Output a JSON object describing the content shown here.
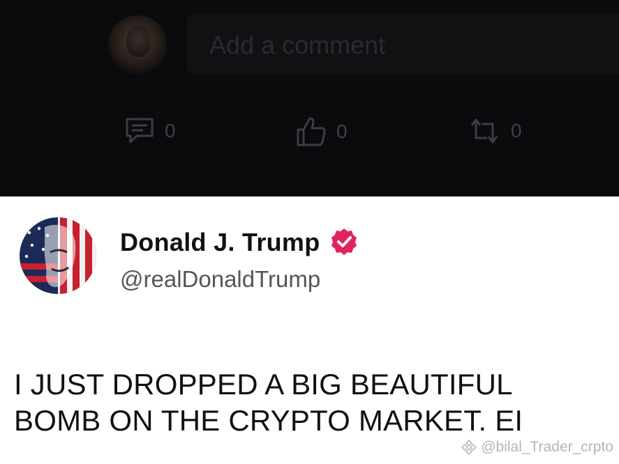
{
  "comment_section": {
    "input_placeholder": "Add a comment",
    "actions": {
      "comments_count": "0",
      "likes_count": "0",
      "reposts_count": "0"
    }
  },
  "tweet": {
    "author_name": "Donald J. Trump",
    "handle": "@realDonaldTrump",
    "verified_badge_color": "#e0245e",
    "text_line_1": "I JUST DROPPED A BIG BEAUTIFUL",
    "text_line_2": "BOMB ON THE CRYPTO MARKET. EI"
  },
  "watermark": {
    "text": "@bilal_Trader_crpto"
  }
}
